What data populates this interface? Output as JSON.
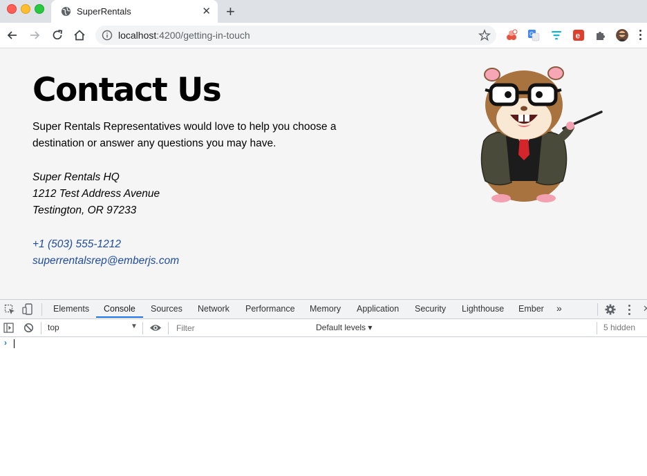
{
  "browser": {
    "tab": {
      "title": "SuperRentals"
    },
    "url": {
      "host": "localhost",
      "rest": ":4200/getting-in-touch"
    }
  },
  "page": {
    "heading": "Contact Us",
    "intro": "Super Rentals Representatives would love to help you choose a destination or answer any questions you may have.",
    "address": [
      "Super Rentals HQ",
      "1212 Test Address Avenue",
      "Testington, OR 97233"
    ],
    "phone": "+1 (503) 555-1212",
    "email": "superrentalsrep@emberjs.com"
  },
  "devtools": {
    "tabs": [
      "Elements",
      "Console",
      "Sources",
      "Network",
      "Performance",
      "Memory",
      "Application",
      "Security",
      "Lighthouse",
      "Ember"
    ],
    "active_tab": "Console",
    "more": "»",
    "context": "top",
    "filter_placeholder": "Filter",
    "levels": "Default levels ▾",
    "hidden_count": "5 hidden",
    "prompt": "›"
  }
}
